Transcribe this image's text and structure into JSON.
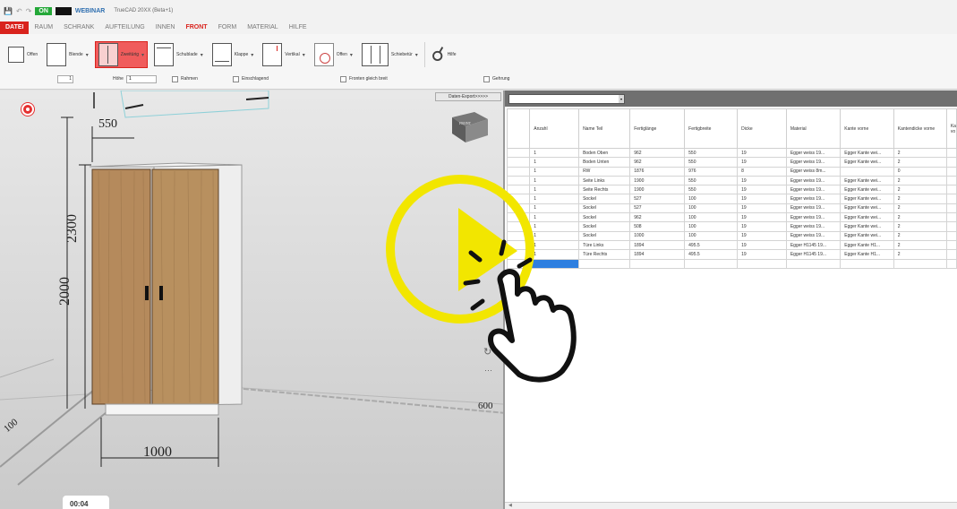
{
  "titlebar": {
    "status_on": "ON",
    "brand": "WEBINAR",
    "window_title": "TrueCAD 20XX (Beta+1)"
  },
  "menu": {
    "items": [
      {
        "label": "DATEI",
        "active": true,
        "accent": true
      },
      {
        "label": "RAUM"
      },
      {
        "label": "SCHRANK"
      },
      {
        "label": "AUFTEILUNG"
      },
      {
        "label": "INNEN"
      },
      {
        "label": "FRONT",
        "active": true
      },
      {
        "label": "FORM"
      },
      {
        "label": "MATERIAL"
      },
      {
        "label": "HILFE"
      }
    ]
  },
  "ribbon": {
    "tools": {
      "offen": "Offen",
      "blende": "Blende",
      "zweitueig": "Zweitürig",
      "schublade": "Schublade",
      "klappe": "Klappe",
      "vertikal": "Vertikal",
      "offen2": "Offen",
      "schiebetuer": "Schiebetür",
      "hilfe": "Hilfe"
    },
    "row2": {
      "spin_value": "1",
      "hoehe_label": "Höhe",
      "hoehe_value": "1",
      "rahmen": "Rahmen",
      "einschlagend": "Einschlagend",
      "fronten_gleich_breit": "Fronten gleich breit",
      "gehrung": "Gehrung"
    }
  },
  "viewport": {
    "export_button": "Daten-Export>>>>>",
    "dim_depth": "550",
    "dim_height_outer": "2300",
    "dim_height_inner": "2000",
    "dim_width": "1000",
    "dim_right": "600",
    "dim_left": "100",
    "nav_cube_label": "FRONT",
    "timestamp": "00:04"
  },
  "colors": {
    "accent": "#d9231d",
    "on_green": "#24a838",
    "wood": "#b58a5c",
    "play_yellow": "#f2e600",
    "selection_blue": "#2e7fe0"
  },
  "table": {
    "columns": [
      "Anzahl",
      "Name Teil",
      "Fertiglänge",
      "Fertigbreite",
      "Dicke",
      "Material",
      "Kante vorne",
      "Kantendicke vorne",
      "Ka vo"
    ],
    "rows": [
      [
        "1",
        "Boden Oben",
        "962",
        "550",
        "19",
        "Egger weiss 19...",
        "Egger Kante wei...",
        "2",
        ""
      ],
      [
        "1",
        "Boden Unten",
        "962",
        "550",
        "19",
        "Egger weiss 19...",
        "Egger Kante wei...",
        "2",
        ""
      ],
      [
        "1",
        "RW",
        "1876",
        "976",
        "8",
        "Egger weiss 8m...",
        "",
        "0",
        ""
      ],
      [
        "1",
        "Seite Links",
        "1900",
        "550",
        "19",
        "Egger weiss 19...",
        "Egger Kante wei...",
        "2",
        ""
      ],
      [
        "1",
        "Seite Rechts",
        "1900",
        "550",
        "19",
        "Egger weiss 19...",
        "Egger Kante wei...",
        "2",
        ""
      ],
      [
        "1",
        "Sockel",
        "527",
        "100",
        "19",
        "Egger weiss 19...",
        "Egger Kante wei...",
        "2",
        ""
      ],
      [
        "1",
        "Sockel",
        "527",
        "100",
        "19",
        "Egger weiss 19...",
        "Egger Kante wei...",
        "2",
        ""
      ],
      [
        "1",
        "Sockel",
        "962",
        "100",
        "19",
        "Egger weiss 19...",
        "Egger Kante wei...",
        "2",
        ""
      ],
      [
        "1",
        "Sockel",
        "508",
        "100",
        "19",
        "Egger weiss 19...",
        "Egger Kante wei...",
        "2",
        ""
      ],
      [
        "1",
        "Sockel",
        "1000",
        "100",
        "19",
        "Egger weiss 19...",
        "Egger Kante wei...",
        "2",
        ""
      ],
      [
        "1",
        "Türe Links",
        "1894",
        "495.5",
        "19",
        "Egger H1145 19...",
        "Egger Kante H1...",
        "2",
        ""
      ],
      [
        "1",
        "Türe Rechts",
        "1894",
        "495.5",
        "19",
        "Egger H1145 19...",
        "Egger Kante H1...",
        "2",
        ""
      ]
    ]
  }
}
